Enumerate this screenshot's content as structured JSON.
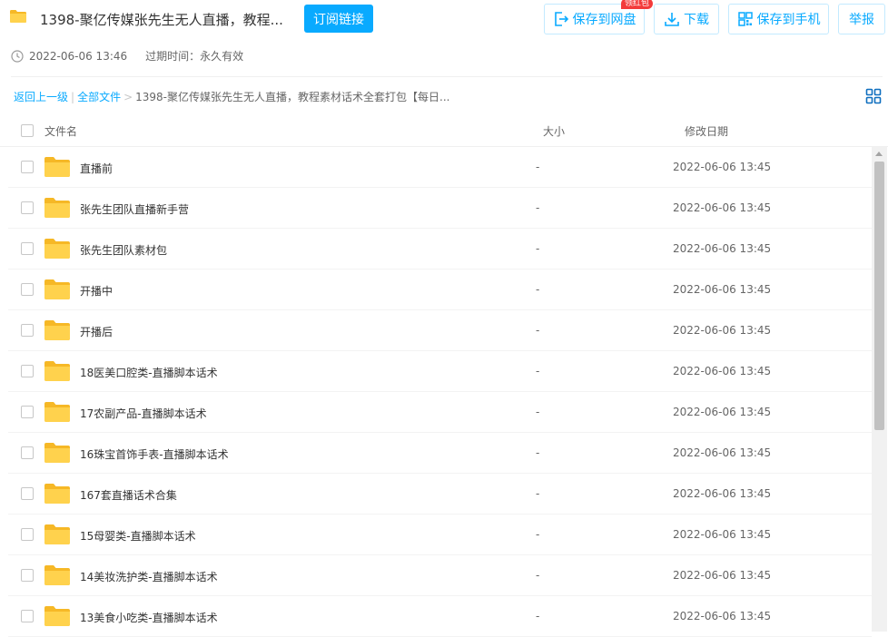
{
  "header": {
    "title": "1398-聚亿传媒张先生无人直播，教程...",
    "subscribe_label": "订阅链接",
    "save_to_disk_label": "保存到网盘",
    "download_label": "下载",
    "save_to_phone_label": "保存到手机",
    "report_label": "举报",
    "badge_label": "领红包"
  },
  "meta": {
    "share_time": "2022-06-06 13:46",
    "expire_text": "过期时间：永久有效"
  },
  "breadcrumb": {
    "back": "返回上一级",
    "all_files": "全部文件",
    "current": "1398-聚亿传媒张先生无人直播，教程素材话术全套打包【每日..."
  },
  "columns": {
    "name": "文件名",
    "size": "大小",
    "date": "修改日期"
  },
  "files": [
    {
      "name": "直播前",
      "size": "-",
      "date": "2022-06-06 13:45"
    },
    {
      "name": "张先生团队直播新手营",
      "size": "-",
      "date": "2022-06-06 13:45"
    },
    {
      "name": "张先生团队素材包",
      "size": "-",
      "date": "2022-06-06 13:45"
    },
    {
      "name": "开播中",
      "size": "-",
      "date": "2022-06-06 13:45"
    },
    {
      "name": "开播后",
      "size": "-",
      "date": "2022-06-06 13:45"
    },
    {
      "name": "18医美口腔类-直播脚本话术",
      "size": "-",
      "date": "2022-06-06 13:45"
    },
    {
      "name": "17农副产品-直播脚本话术",
      "size": "-",
      "date": "2022-06-06 13:45"
    },
    {
      "name": "16珠宝首饰手表-直播脚本话术",
      "size": "-",
      "date": "2022-06-06 13:45"
    },
    {
      "name": "167套直播话术合集",
      "size": "-",
      "date": "2022-06-06 13:45"
    },
    {
      "name": "15母婴类-直播脚本话术",
      "size": "-",
      "date": "2022-06-06 13:45"
    },
    {
      "name": "14美妆洗护类-直播脚本话术",
      "size": "-",
      "date": "2022-06-06 13:45"
    },
    {
      "name": "13美食小吃类-直播脚本话术",
      "size": "-",
      "date": "2022-06-06 13:45"
    }
  ],
  "colors": {
    "accent": "#09aaff",
    "folder": "#ffd24d",
    "badge": "#f33b3b"
  }
}
